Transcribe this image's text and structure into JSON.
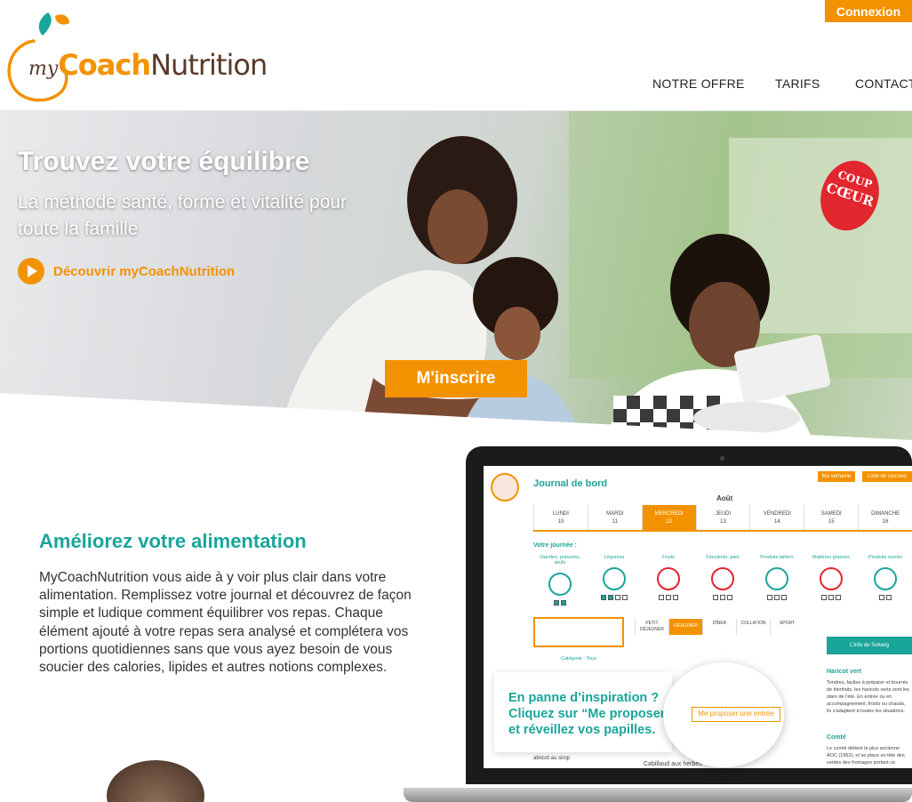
{
  "brand": {
    "my": "my",
    "coach": "Coach",
    "nutrition": "Nutrition",
    "colors": {
      "orange": "#f39200",
      "teal": "#1aa59a",
      "brown": "#5a3a2a"
    }
  },
  "header": {
    "connexion": "Connexion",
    "nav": {
      "offre": "NOTRE OFFRE",
      "tarifs": "TARIFS",
      "contact": "CONTACT"
    }
  },
  "hero": {
    "title": "Trouvez votre équilibre",
    "subtitle": "La méthode santé, forme et vitalité pour toute la famille",
    "discover": "Découvrir myCoachNutrition",
    "cta": "M'inscrire",
    "badge": {
      "line1": "COUP",
      "line2": "CŒUR"
    }
  },
  "section": {
    "title": "Améliorez votre alimentation",
    "body": "MyCoachNutrition vous aide à y voir plus clair dans votre alimentation. Remplissez votre journal et découvrez de façon simple et ludique comment équilibrer vos repas. Chaque élément ajouté à votre repas sera analysé et complétera vos portions quotidiennes sans que vous ayez besoin de vous soucier des calories, lipides et autres notions complexes."
  },
  "app": {
    "title": "Journal de bord",
    "btn_semaine": "Ma semaine",
    "btn_courses": "Liste de courses",
    "month": "Août",
    "days": [
      {
        "name": "LUNDI",
        "num": "10"
      },
      {
        "name": "MARDI",
        "num": "11"
      },
      {
        "name": "MERCREDI",
        "num": "12"
      },
      {
        "name": "JEUDI",
        "num": "13"
      },
      {
        "name": "VENDREDI",
        "num": "14"
      },
      {
        "name": "SAMEDI",
        "num": "15"
      },
      {
        "name": "DIMANCHE",
        "num": "16"
      }
    ],
    "journee": "Votre journée :",
    "foods": [
      "Viandes, poissons, œufs",
      "Légumes",
      "Fruits",
      "Féculents, pain",
      "Produits laitiers",
      "Matières grasses",
      "Produits sucrés"
    ],
    "categorie": "Catégorie : Tous",
    "meals": [
      "PETIT DÉJEUNER",
      "DÉJEUNER",
      "DÎNER",
      "COLLATION",
      "SPORT"
    ],
    "info_head": "L'info de Solveig",
    "info_name1": "Haricot vert",
    "info_text1": "Tendres, faciles à préparer et bourrés de bienfaits, les haricots verts sont les stars de l'été. En entrée ou en accompagnement, froids ou chauds, ils s'adaptent à toutes les situations.",
    "info_name2": "Comté",
    "info_text2": "Le comté détient la plus ancienne AOC (1952), et se place en tête des ventes des fromages portant ce",
    "item1": "abricot au sirop",
    "item2": "Cabillaud aux herbes"
  },
  "callout": {
    "line1": "En panne d’inspiration ?",
    "line2": "Cliquez sur “Me proposer...”",
    "line3": "et réveillez vos papilles.",
    "button": "Me proposer une entrée"
  }
}
